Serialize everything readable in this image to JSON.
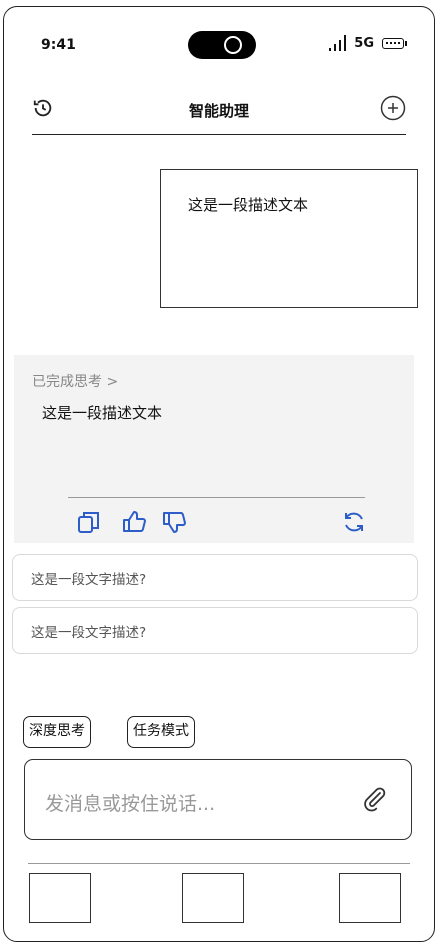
{
  "status_bar": {
    "time": "9:41",
    "network": "5G"
  },
  "header": {
    "title": "智能助理",
    "history_icon": "history-icon",
    "add_icon": "plus-circle-icon"
  },
  "chat": {
    "user_message": "这是一段描述文本",
    "answer": {
      "thinking_label": "已完成思考 >",
      "text": "这是一段描述文本",
      "actions": [
        "copy-icon",
        "thumbs-up-icon",
        "thumbs-down-icon",
        "refresh-icon"
      ]
    }
  },
  "suggestions": [
    "这是一段文字描述?",
    "这是一段文字描述?"
  ],
  "modes": {
    "deep_think": "深度思考",
    "task_mode": "任务模式"
  },
  "composer": {
    "placeholder": "发消息或按住说话...",
    "attach_icon": "paperclip-icon"
  },
  "bottom_tabs": [
    "tab-1",
    "tab-2",
    "tab-3"
  ]
}
